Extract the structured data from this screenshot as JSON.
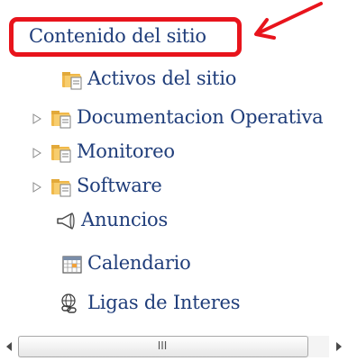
{
  "tree": {
    "root_label": "Contenido del sitio",
    "items": [
      {
        "label": "Activos del sitio",
        "icon": "folder-page-icon",
        "expandable": false
      },
      {
        "label": "Documentacion Operativa",
        "icon": "folder-page-icon",
        "expandable": true
      },
      {
        "label": "Monitoreo",
        "icon": "folder-page-icon",
        "expandable": true
      },
      {
        "label": "Software",
        "icon": "folder-page-icon",
        "expandable": true
      },
      {
        "label": "Anuncios",
        "icon": "megaphone-icon",
        "expandable": false
      },
      {
        "label": "Calendario",
        "icon": "calendar-icon",
        "expandable": false
      },
      {
        "label": "Ligas de Interes",
        "icon": "links-globe-icon",
        "expandable": false
      }
    ]
  },
  "scrollbar": {
    "grip_label": "III"
  },
  "colors": {
    "highlight": "#e8141c",
    "link_text": "#1f3d7a",
    "folder": "#f0b84a"
  }
}
